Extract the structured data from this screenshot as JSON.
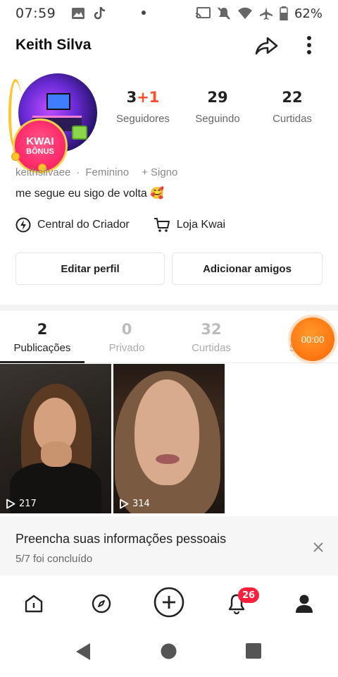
{
  "status_bar": {
    "time": "07:59",
    "battery": "62%"
  },
  "header": {
    "title": "Keith Silva"
  },
  "avatar_badge": {
    "title": "KWAI",
    "subtitle": "BÔNUS"
  },
  "stats": [
    {
      "value": "3",
      "plus": "+1",
      "label": "Seguidores"
    },
    {
      "value": "29",
      "plus": "",
      "label": "Seguindo"
    },
    {
      "value": "22",
      "plus": "",
      "label": "Curtidas"
    }
  ],
  "profile": {
    "username": "keithsilvaee",
    "separator": "·",
    "gender": "Feminino",
    "sign": "+ Signo",
    "bio": "me segue eu sigo de volta 🥰"
  },
  "links": {
    "creator_center": "Central do Criador",
    "store": "Loja Kwai"
  },
  "buttons": {
    "edit_profile": "Editar perfil",
    "add_friends": "Adicionar amigos"
  },
  "tabs": [
    {
      "count": "2",
      "label": "Publicações"
    },
    {
      "count": "0",
      "label": "Privado"
    },
    {
      "count": "32",
      "label": "Curtidas"
    },
    {
      "count": "",
      "label": "Sa"
    }
  ],
  "timer": "00:00",
  "videos": [
    {
      "plays": "217"
    },
    {
      "plays": "314"
    }
  ],
  "prompt": {
    "title": "Preencha suas informações pessoais",
    "subtitle": "5/7 foi concluído"
  },
  "bottom_nav": {
    "notification_count": "26"
  },
  "colors": {
    "accent_orange": "#ff7a12",
    "badge_red": "#ff1f3a",
    "plus_red": "#ff4e2b"
  }
}
